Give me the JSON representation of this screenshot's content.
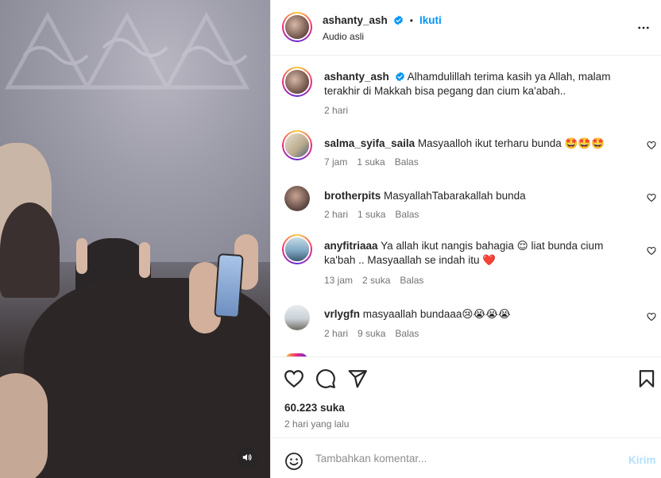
{
  "post": {
    "username": "ashanty_ash",
    "follow_label": "Ikuti",
    "separator": "•",
    "audio_label": "Audio asli",
    "caption_user": "ashanty_ash",
    "caption_text": "Alhamdulillah terima kasih ya Allah, malam terakhir di Makkah bisa pegang dan cium ka'abah..",
    "caption_time": "2 hari",
    "likes": "60.223 suka",
    "posted": "2 hari yang lalu"
  },
  "comments": [
    {
      "user": "salma_syifa_saila",
      "text": "Masyaalloh ikut terharu bunda 🤩🤩🤩",
      "time": "7 jam",
      "likes": "1 suka",
      "reply": "Balas"
    },
    {
      "user": "brotherpits",
      "text": "MasyallahTabarakallah bunda",
      "time": "2 hari",
      "likes": "1 suka",
      "reply": "Balas"
    },
    {
      "user": "anyfitriaaa",
      "text": "Ya allah ikut nangis bahagia 😌 liat bunda cium ka'bah .. Masyaallah se indah itu ❤️",
      "time": "13 jam",
      "likes": "2 suka",
      "reply": "Balas"
    },
    {
      "user": "vrlygfn",
      "text": "masyaallah bundaaa😢😭😭😭",
      "time": "2 hari",
      "likes": "9 suka",
      "reply": "Balas"
    }
  ],
  "composer": {
    "placeholder": "Tambahkan komentar...",
    "send_label": "Kirim"
  },
  "icons": {
    "verified": "verified-badge-icon",
    "more": "more-options-icon",
    "like": "heart-icon",
    "comment": "comment-icon",
    "share": "send-icon",
    "save": "bookmark-icon",
    "emoji": "emoji-icon",
    "sound": "speaker-icon"
  },
  "colors": {
    "link_blue": "#0095f6",
    "text": "#262626",
    "muted": "#737373",
    "send_disabled": "#b2dffc"
  }
}
